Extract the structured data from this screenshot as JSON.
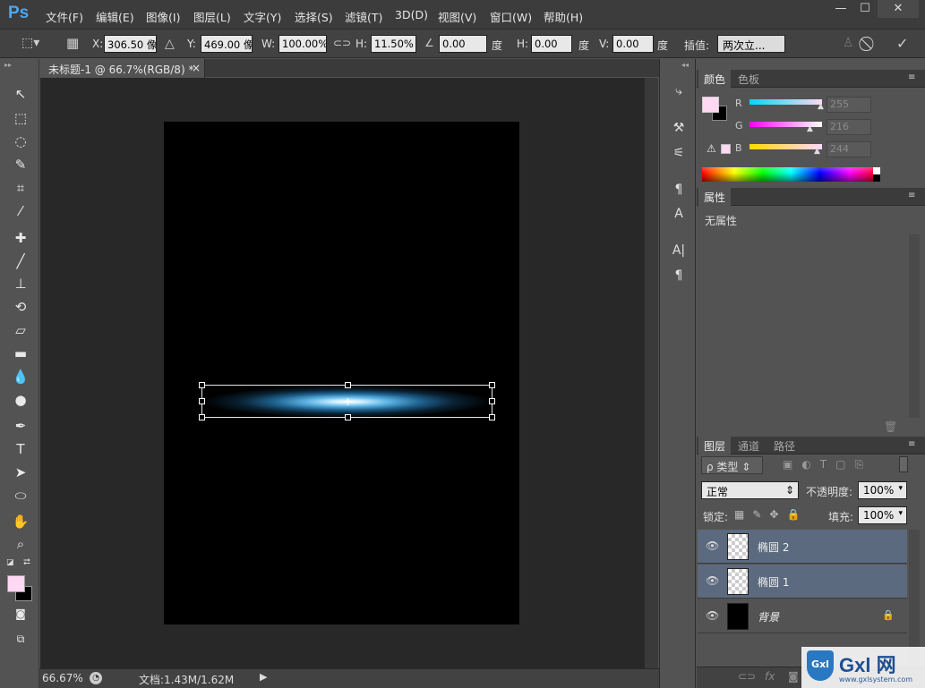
{
  "app": {
    "logo": "Ps"
  },
  "menu": [
    "文件(F)",
    "编辑(E)",
    "图像(I)",
    "图层(L)",
    "文字(Y)",
    "选择(S)",
    "滤镜(T)",
    "3D(D)",
    "视图(V)",
    "窗口(W)",
    "帮助(H)"
  ],
  "window_controls": {
    "minimize": "—",
    "maximize": "☐",
    "close": "✕"
  },
  "options": {
    "x_label": "X:",
    "x_value": "306.50 像",
    "y_label": "Y:",
    "y_value": "469.00 像",
    "w_label": "W:",
    "w_value": "100.00%",
    "h_label": "H:",
    "h_value": "11.50%",
    "angle_value": "0.00",
    "angle_unit": "度",
    "hskew_label": "H:",
    "hskew_value": "0.00",
    "hskew_unit": "度",
    "vskew_label": "V:",
    "vskew_value": "0.00",
    "vskew_unit": "度",
    "interp_label": "插值:",
    "interp_value": "两次立..."
  },
  "document_tab": {
    "title": "未标题-1 @ 66.7%(RGB/8) *",
    "close": "×"
  },
  "status": {
    "zoom": "66.67%",
    "doc_info": "文档:1.43M/1.62M"
  },
  "color_panel": {
    "tabs": [
      "颜色",
      "色板"
    ],
    "r_label": "R",
    "g_label": "G",
    "b_label": "B",
    "r": "255",
    "g": "216",
    "b": "244",
    "foreground": "#ffd8f4",
    "background": "#000000"
  },
  "properties_panel": {
    "tab": "属性",
    "empty_text": "无属性"
  },
  "layers_panel": {
    "tabs": [
      "图层",
      "通道",
      "路径"
    ],
    "filter_label": "ρ 类型",
    "blend_mode": "正常",
    "opacity_label": "不透明度:",
    "opacity": "100%",
    "lock_label": "锁定:",
    "fill_label": "填充:",
    "fill": "100%",
    "layers": [
      {
        "name": "椭圆 2",
        "selected": true
      },
      {
        "name": "椭圆 1",
        "selected": true
      },
      {
        "name": "背景",
        "selected": false
      }
    ]
  },
  "watermark": {
    "brand": "Gxl 网",
    "url": "www.gxlsystem.com"
  }
}
